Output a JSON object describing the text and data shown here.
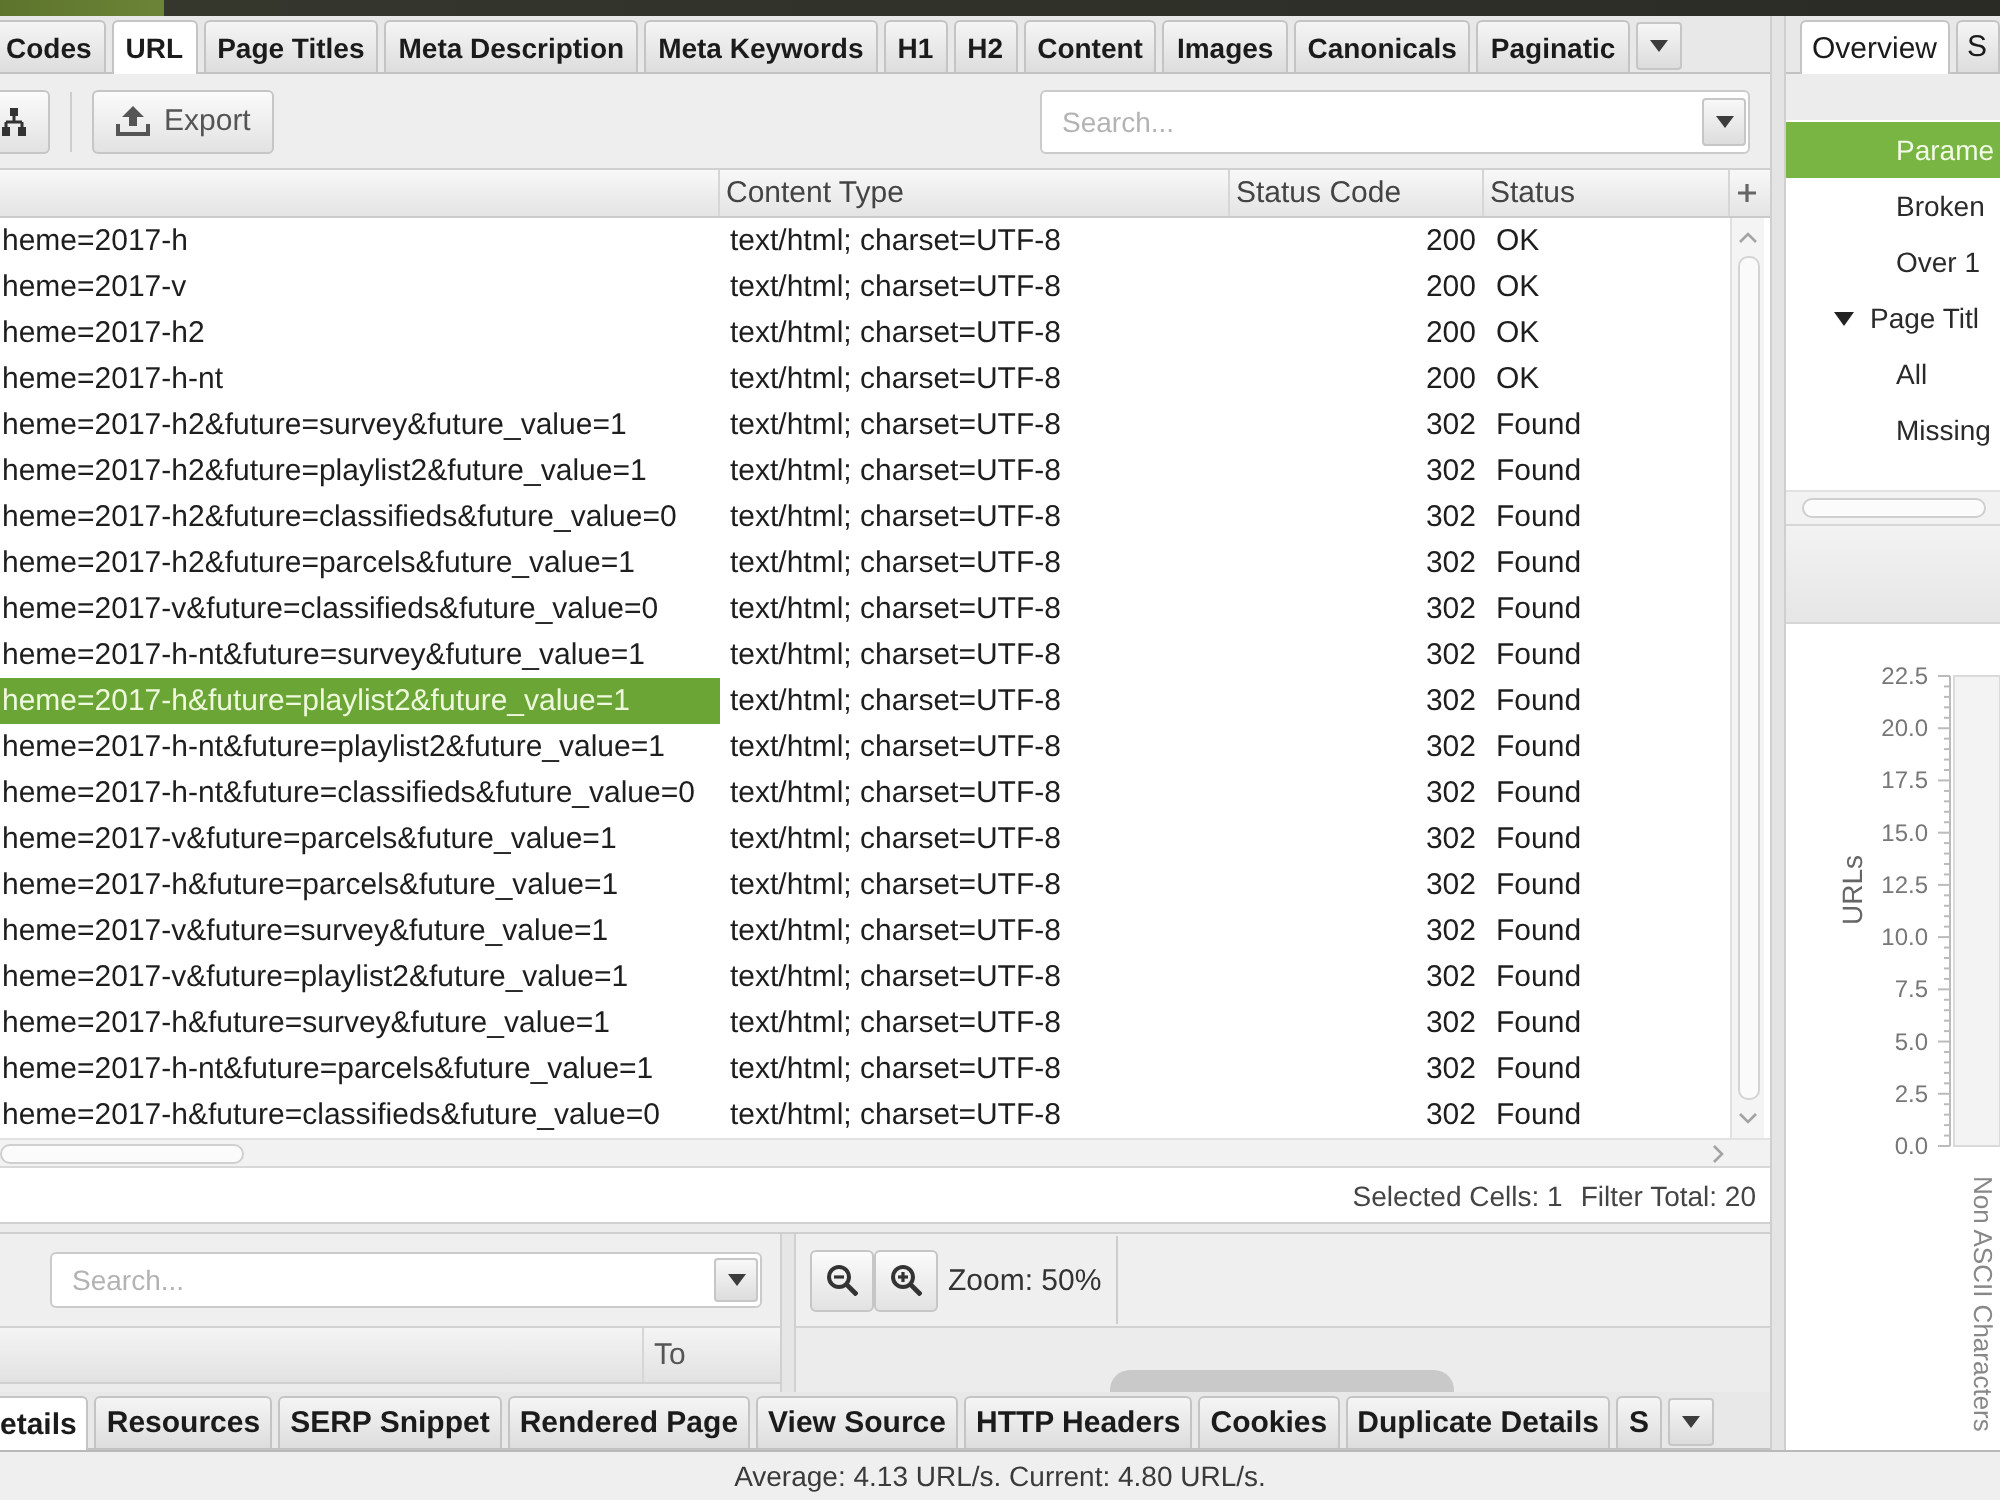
{
  "tabs": [
    {
      "label": "Codes",
      "selected": false
    },
    {
      "label": "URL",
      "selected": true
    },
    {
      "label": "Page Titles",
      "selected": false
    },
    {
      "label": "Meta Description",
      "selected": false
    },
    {
      "label": "Meta Keywords",
      "selected": false
    },
    {
      "label": "H1",
      "selected": false
    },
    {
      "label": "H2",
      "selected": false
    },
    {
      "label": "Content",
      "selected": false
    },
    {
      "label": "Images",
      "selected": false
    },
    {
      "label": "Canonicals",
      "selected": false
    },
    {
      "label": "Paginatic",
      "selected": false
    }
  ],
  "toolbar": {
    "export_label": "Export",
    "search": {
      "placeholder": "Search..."
    }
  },
  "table": {
    "columns": [
      "Content Type",
      "Status Code",
      "Status"
    ],
    "rows": [
      {
        "address": "heme=2017-h",
        "content_type": "text/html; charset=UTF-8",
        "status_code": "200",
        "status": "OK",
        "selected": false
      },
      {
        "address": "heme=2017-v",
        "content_type": "text/html; charset=UTF-8",
        "status_code": "200",
        "status": "OK",
        "selected": false
      },
      {
        "address": "heme=2017-h2",
        "content_type": "text/html; charset=UTF-8",
        "status_code": "200",
        "status": "OK",
        "selected": false
      },
      {
        "address": "heme=2017-h-nt",
        "content_type": "text/html; charset=UTF-8",
        "status_code": "200",
        "status": "OK",
        "selected": false
      },
      {
        "address": "heme=2017-h2&future=survey&future_value=1",
        "content_type": "text/html; charset=UTF-8",
        "status_code": "302",
        "status": "Found",
        "selected": false
      },
      {
        "address": "heme=2017-h2&future=playlist2&future_value=1",
        "content_type": "text/html; charset=UTF-8",
        "status_code": "302",
        "status": "Found",
        "selected": false
      },
      {
        "address": "heme=2017-h2&future=classifieds&future_value=0",
        "content_type": "text/html; charset=UTF-8",
        "status_code": "302",
        "status": "Found",
        "selected": false
      },
      {
        "address": "heme=2017-h2&future=parcels&future_value=1",
        "content_type": "text/html; charset=UTF-8",
        "status_code": "302",
        "status": "Found",
        "selected": false
      },
      {
        "address": "heme=2017-v&future=classifieds&future_value=0",
        "content_type": "text/html; charset=UTF-8",
        "status_code": "302",
        "status": "Found",
        "selected": false
      },
      {
        "address": "heme=2017-h-nt&future=survey&future_value=1",
        "content_type": "text/html; charset=UTF-8",
        "status_code": "302",
        "status": "Found",
        "selected": false
      },
      {
        "address": "heme=2017-h&future=playlist2&future_value=1",
        "content_type": "text/html; charset=UTF-8",
        "status_code": "302",
        "status": "Found",
        "selected": true
      },
      {
        "address": "heme=2017-h-nt&future=playlist2&future_value=1",
        "content_type": "text/html; charset=UTF-8",
        "status_code": "302",
        "status": "Found",
        "selected": false
      },
      {
        "address": "heme=2017-h-nt&future=classifieds&future_value=0",
        "content_type": "text/html; charset=UTF-8",
        "status_code": "302",
        "status": "Found",
        "selected": false
      },
      {
        "address": "heme=2017-v&future=parcels&future_value=1",
        "content_type": "text/html; charset=UTF-8",
        "status_code": "302",
        "status": "Found",
        "selected": false
      },
      {
        "address": "heme=2017-h&future=parcels&future_value=1",
        "content_type": "text/html; charset=UTF-8",
        "status_code": "302",
        "status": "Found",
        "selected": false
      },
      {
        "address": "heme=2017-v&future=survey&future_value=1",
        "content_type": "text/html; charset=UTF-8",
        "status_code": "302",
        "status": "Found",
        "selected": false
      },
      {
        "address": "heme=2017-v&future=playlist2&future_value=1",
        "content_type": "text/html; charset=UTF-8",
        "status_code": "302",
        "status": "Found",
        "selected": false
      },
      {
        "address": "heme=2017-h&future=survey&future_value=1",
        "content_type": "text/html; charset=UTF-8",
        "status_code": "302",
        "status": "Found",
        "selected": false
      },
      {
        "address": "heme=2017-h-nt&future=parcels&future_value=1",
        "content_type": "text/html; charset=UTF-8",
        "status_code": "302",
        "status": "Found",
        "selected": false
      },
      {
        "address": "heme=2017-h&future=classifieds&future_value=0",
        "content_type": "text/html; charset=UTF-8",
        "status_code": "302",
        "status": "Found",
        "selected": false
      }
    ]
  },
  "summary": {
    "selected_cells": "Selected Cells: 1",
    "filter_total": "Filter Total: 20"
  },
  "details_panel": {
    "search": {
      "placeholder": "Search..."
    },
    "column_header": "To",
    "zoom_label": "Zoom: 50%",
    "tabs": [
      {
        "label": "etails",
        "selected": true
      },
      {
        "label": "Resources",
        "selected": false
      },
      {
        "label": "SERP Snippet",
        "selected": false
      },
      {
        "label": "Rendered Page",
        "selected": false
      },
      {
        "label": "View Source",
        "selected": false
      },
      {
        "label": "HTTP Headers",
        "selected": false
      },
      {
        "label": "Cookies",
        "selected": false
      },
      {
        "label": "Duplicate Details",
        "selected": false
      },
      {
        "label": "S",
        "selected": false
      }
    ]
  },
  "right_panel": {
    "tabs": [
      {
        "label": "Overview",
        "selected": true
      },
      {
        "label": "S",
        "selected": false
      }
    ],
    "tree": [
      {
        "label": "Parame",
        "selected": true
      },
      {
        "label": "Broken",
        "selected": false
      },
      {
        "label": "Over 1",
        "selected": false
      },
      {
        "label": "Page Titl",
        "selected": false,
        "expanded": true,
        "children": [
          {
            "label": "All",
            "selected": false
          },
          {
            "label": "Missing",
            "selected": false
          }
        ]
      }
    ],
    "chart": {
      "ylabel": "URLs",
      "yticks": [
        "22.5",
        "20.0",
        "17.5",
        "15.0",
        "12.5",
        "10.0",
        "7.5",
        "5.0",
        "2.5",
        "0.0"
      ],
      "category": "Non ASCII Characters"
    }
  },
  "status_bar": "Average: 4.13 URL/s. Current: 4.80 URL/s."
}
